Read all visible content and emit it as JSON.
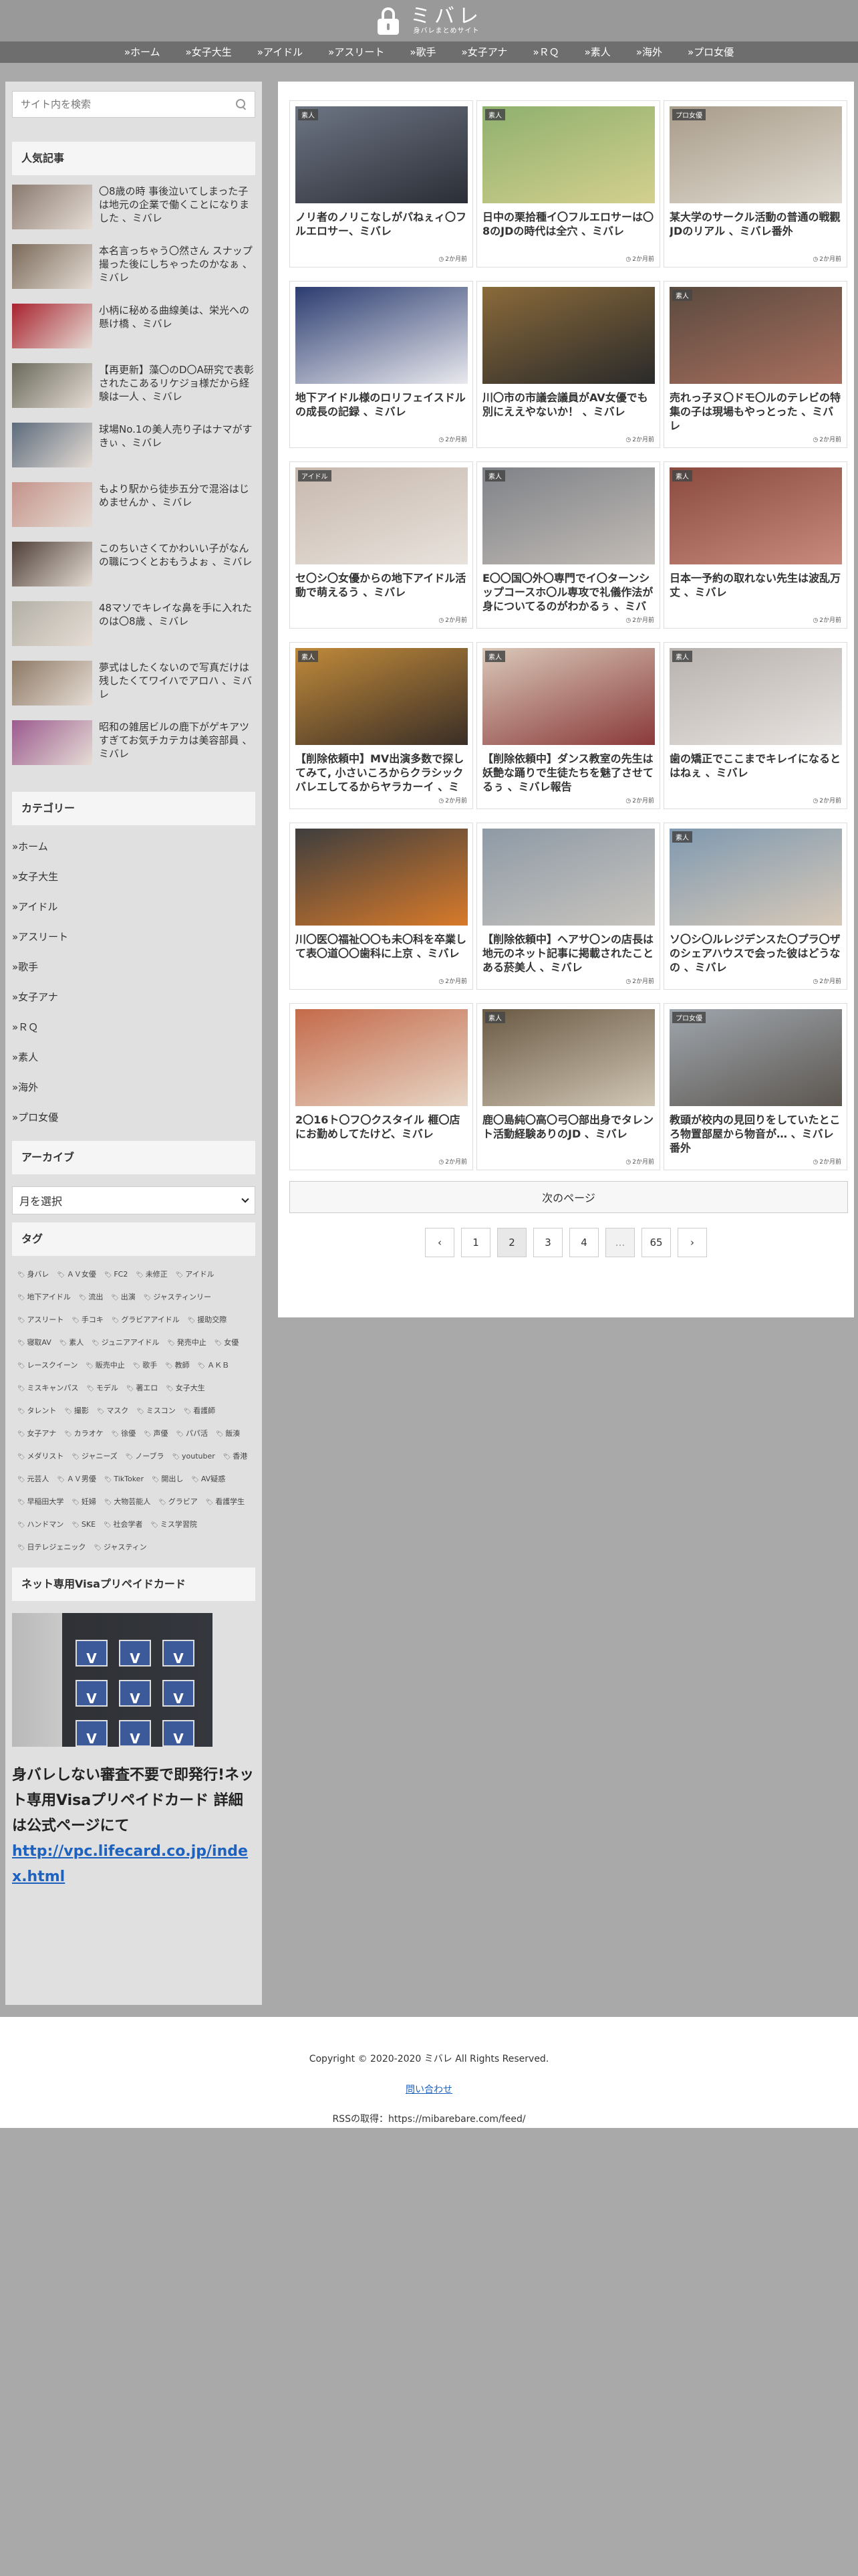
{
  "site": {
    "logo_text": "ミバレ",
    "logo_sub": "身バレまとめサイト"
  },
  "nav": [
    "»ホーム",
    "»女子大生",
    "»アイドル",
    "»アスリート",
    "»歌手",
    "»女子アナ",
    "»ＲＱ",
    "»素人",
    "»海外",
    "»プロ女優"
  ],
  "sidebar": {
    "search_placeholder": "サイト内を検索",
    "popular_title": "人気記事",
    "popular": [
      {
        "title": "〇8歳の時 事後泣いてしまった子は地元の企業で働くことになりました 、ミバレ",
        "color": "#8a7a70"
      },
      {
        "title": "本名言っちゃう〇然さん スナップ撮った後にしちゃったのかなぁ 、ミバレ",
        "color": "#7a6a5a"
      },
      {
        "title": "小柄に秘める曲線美は、栄光への懸け橋 、ミバレ",
        "color": "#a8232f"
      },
      {
        "title": "【再更新】藻〇のD〇A研究で表彰されたこあるリケジョ様だから経験は一人 、ミバレ",
        "color": "#6a6a5c"
      },
      {
        "title": "球場No.1の美人売り子はナマがすきぃ 、ミバレ",
        "color": "#5c6b7c"
      },
      {
        "title": "もより駅から徒歩五分で混浴はじめませんか 、ミバレ",
        "color": "#c4938a"
      },
      {
        "title": "このちいさくてかわいい子がなんの職につくとおもうよぉ 、ミバレ",
        "color": "#4f4038"
      },
      {
        "title": "48マソでキレイな鼻を手に入れたのは〇8歳 、ミバレ",
        "color": "#b3b0a6"
      },
      {
        "title": "夢式はしたくないので写真だけは残したくてワイハでアロハ 、ミバレ",
        "color": "#8e7a66"
      },
      {
        "title": "昭和の雑居ビルの鹿下がゲキアツすぎてお気チカテカは美容部員 、ミバレ",
        "color": "#9b5a8e"
      }
    ],
    "category_title": "カテゴリー",
    "categories": [
      "»ホーム",
      "»女子大生",
      "»アイドル",
      "»アスリート",
      "»歌手",
      "»女子アナ",
      "»ＲＱ",
      "»素人",
      "»海外",
      "»プロ女優"
    ],
    "archive_title": "アーカイブ",
    "archive_select": "月を選択",
    "tags_title": "タグ",
    "tags": [
      "身バレ",
      "ＡＶ女優",
      "FC2",
      "未修正",
      "アイドル",
      "地下アイドル",
      "流出",
      "出演",
      "ジャスティンリー",
      "アスリート",
      "手コキ",
      "グラビアアイドル",
      "援助交際",
      "寝取AV",
      "素人",
      "ジュニアアイドル",
      "発売中止",
      "女優",
      "レースクイーン",
      "販売中止",
      "歌手",
      "教師",
      "ＡＫＢ",
      "ミスキャンパス",
      "モデル",
      "著エロ",
      "女子大生",
      "タレント",
      "撮影",
      "マスク",
      "ミスコン",
      "看護師",
      "女子アナ",
      "カラオケ",
      "徐優",
      "声優",
      "パパ活",
      "飯湊",
      "メダリスト",
      "ジャニーズ",
      "ノーブラ",
      "youtuber",
      "香港",
      "元芸人",
      "ＡＶ男優",
      "TikToker",
      "開出し",
      "AV疑惑",
      "早稲田大学",
      "妊婦",
      "大物芸能人",
      "グラビア",
      "看護学生",
      "ハンドマン",
      "SKE",
      "社会学者",
      "ミス学習院",
      "日テレジェニック",
      "ジャスティン"
    ],
    "ad_title": "ネット専用Visaプリペイドカード",
    "ad_text": "身バレしない審査不要で即発行!ネット専用Visaプリペイドカード 詳細は公式ページにて",
    "ad_url": "http://vpc.lifecard.co.jp/index.html"
  },
  "articles": [
    {
      "title": "ノリ者のノリこなしがパねぇィ〇フルエロサー、ミバレ",
      "badge": "素人",
      "date": "2か月前",
      "c1": "#6d7584",
      "c2": "#2b2e36"
    },
    {
      "title": "日中の栗拾種イ〇フルエロサーは〇8のJDの時代は全穴 、ミバレ",
      "badge": "素人",
      "date": "2か月前",
      "c1": "#8fb06e",
      "c2": "#d4d08e"
    },
    {
      "title": "某大学のサークル活動の普通の戦觀JDのリアル 、ミバレ番外",
      "badge": "プロ女優",
      "date": "2か月前",
      "c1": "#a89c8a",
      "c2": "#e0dad0"
    },
    {
      "title": "地下アイドル様のロリフェイスドルの成長の記録 、ミバレ",
      "badge": "",
      "date": "2か月前",
      "c1": "#2b3c70",
      "c2": "#e9e9ee"
    },
    {
      "title": "川〇市の市議会議員がAV女優でも別にええやないか！ 、ミバレ",
      "badge": "",
      "date": "2か月前",
      "c1": "#8a6a3a",
      "c2": "#2a2a2a"
    },
    {
      "title": "売れっ子ヌ〇ドモ〇ルのテレビの特集の子は現場もやっとった 、ミバレ",
      "badge": "素人",
      "date": "2か月前",
      "c1": "#5a4a3e",
      "c2": "#a86f5f"
    },
    {
      "title": "セ〇シ〇女優からの地下アイドル活動で萌えるう 、ミバレ",
      "badge": "アイドル",
      "date": "2か月前",
      "c1": "#c7b8ad",
      "c2": "#e8e2dc"
    },
    {
      "title": "E〇〇国〇外〇専門でイ〇ターンシップコースホ〇ル専攻で礼儀作法が身についてるのがわかるぅ 、ミバレ",
      "badge": "素人",
      "date": "2か月前",
      "c1": "#7f8288",
      "c2": "#c2bcb6"
    },
    {
      "title": "日本一予約の取れない先生は波乱万丈 、ミバレ",
      "badge": "素人",
      "date": "2か月前",
      "c1": "#8a4a3e",
      "c2": "#c98a7e"
    },
    {
      "title": "【削除依頼中】MV出演多数で探してみて, 小さいころからクラシックバレエしてるからヤラカーイ 、ミバレ",
      "badge": "素人",
      "date": "2か月前",
      "c1": "#c08a3a",
      "c2": "#3a2e26"
    },
    {
      "title": "【削除依頼中】ダンス教室の先生は妖艶な踊りで生徒たちを魅了させてるぅ 、ミバレ報告",
      "badge": "素人",
      "date": "2か月前",
      "c1": "#d9c8b8",
      "c2": "#8a3a3a"
    },
    {
      "title": "歯の矯正でここまでキレイになるとはねぇ 、ミバレ",
      "badge": "素人",
      "date": "2か月前",
      "c1": "#b8b2ae",
      "c2": "#e6e2df"
    },
    {
      "title": "川〇医〇福祉〇〇も未〇科を卒業して表〇道〇〇歯科に上京 、ミバレ",
      "badge": "",
      "date": "2か月前",
      "c1": "#3e3e3e",
      "c2": "#d87a2a"
    },
    {
      "title": "【削除依頼中】ヘアサ〇ンの店長は地元のネット記事に掲載されたことある菸美人 、ミバレ",
      "badge": "",
      "date": "2か月前",
      "c1": "#8e9aa6",
      "c2": "#c8c4be"
    },
    {
      "title": "ソ〇シ〇ルレジデンスた〇プラ〇ザのシェアハウスで会った彼はどうなの 、ミバレ",
      "badge": "素人",
      "date": "2か月前",
      "c1": "#7f99b0",
      "c2": "#d7c9b8"
    },
    {
      "title": "2〇16ト〇フ〇クスタイル 榧〇店にお勤めしてたけど、ミバレ",
      "badge": "",
      "date": "2か月前",
      "c1": "#c46a4a",
      "c2": "#e7d6c6"
    },
    {
      "title": "鹿〇島純〇高〇弓〇部出身でタレント活動経験ありのJD 、ミバレ",
      "badge": "素人",
      "date": "2か月前",
      "c1": "#6a5a44",
      "c2": "#d0c6b4"
    },
    {
      "title": "教頭が校内の見回りをしていたところ物置部屋から物音が… 、ミバレ番外",
      "badge": "プロ女優",
      "date": "2か月前",
      "c1": "#9fa6ad",
      "c2": "#5c5650"
    }
  ],
  "next_page_label": "次のページ",
  "pagination": [
    "‹",
    "1",
    "2",
    "3",
    "4",
    "…",
    "65",
    "›"
  ],
  "footer": {
    "copyright": "Copyright © 2020-2020 ミバレ All Rights Reserved.",
    "contact": "問い合わせ",
    "rss": "RSSの取得：https://mibarebare.com/feed/"
  }
}
